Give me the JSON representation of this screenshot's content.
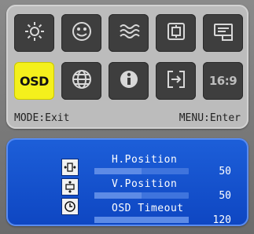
{
  "main_menu": {
    "tiles": [
      {
        "icon": "brightness-icon",
        "selected": false
      },
      {
        "icon": "image-face-icon",
        "selected": false
      },
      {
        "icon": "color-waves-icon",
        "selected": false
      },
      {
        "icon": "image-setup-icon",
        "selected": false
      },
      {
        "icon": "monitor-settings-icon",
        "selected": false
      },
      {
        "icon": "osd-icon",
        "label": "OSD",
        "selected": true
      },
      {
        "icon": "language-globe-icon",
        "selected": false
      },
      {
        "icon": "information-icon",
        "selected": false
      },
      {
        "icon": "input-source-icon",
        "selected": false
      },
      {
        "icon": "aspect-ratio-icon",
        "label": "16:9",
        "selected": false
      }
    ]
  },
  "hints": {
    "left": "MODE:Exit",
    "right": "MENU:Enter"
  },
  "submenu": {
    "items": [
      {
        "icon": "horizontal-position-icon",
        "label": "H.Position",
        "value": "50",
        "level": 0.5
      },
      {
        "icon": "vertical-position-icon",
        "label": "V.Position",
        "value": "50",
        "level": 0.5
      },
      {
        "icon": "clock-icon",
        "label": "OSD Timeout",
        "value": "120",
        "level": 1.0
      }
    ]
  },
  "colors": {
    "selected_tile": "#f4f01c",
    "tile": "#3e3e3e",
    "panel_top": "#bcbcbc",
    "panel_bottom": "#1d5fd9"
  }
}
